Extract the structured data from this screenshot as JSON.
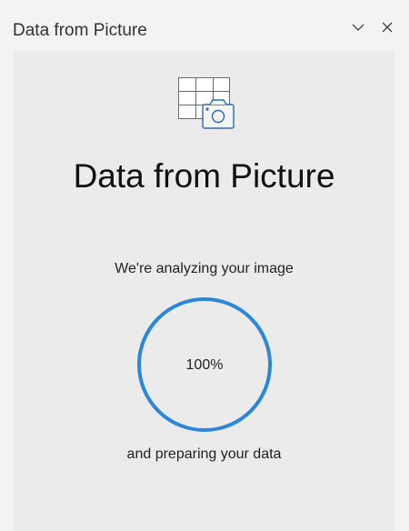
{
  "pane": {
    "title": "Data from Picture",
    "options_icon": "chevron-down-icon",
    "close_icon": "close-icon"
  },
  "card": {
    "hero_icon": "table-camera-icon",
    "title": "Data from Picture",
    "status_top": "We're analyzing your image",
    "progress_label": "100%",
    "progress_value": 1.0,
    "status_bottom": "and preparing your data"
  },
  "colors": {
    "accent": "#2b88d8",
    "card_background": "#ebebeb",
    "pane_background": "#f3f3f3"
  }
}
